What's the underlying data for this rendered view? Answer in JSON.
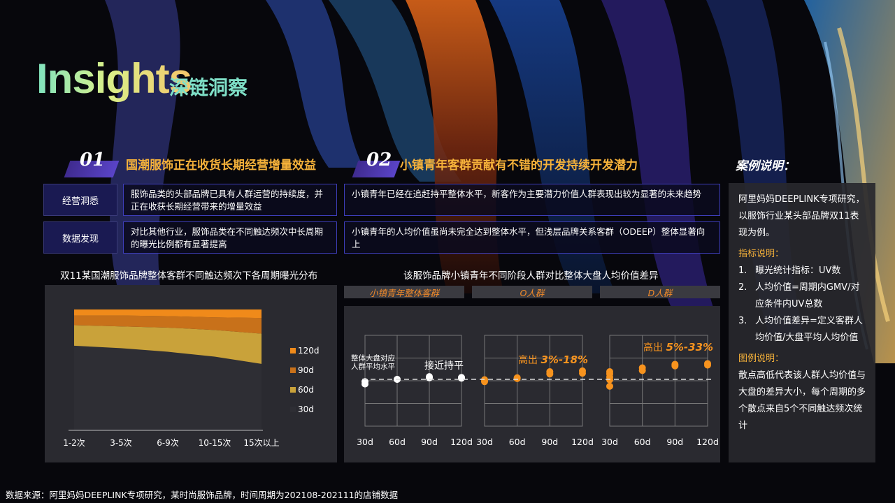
{
  "header": {
    "title_en": "Insights",
    "title_cn": "深链洞察"
  },
  "sections": [
    {
      "num": "01",
      "title": "国潮服饰正在收货长期经营增量效益"
    },
    {
      "num": "02",
      "title": "小镇青年客群贡献有不错的开发持续开发潜力"
    }
  ],
  "rows": [
    {
      "label": "经营洞悉",
      "text1": "服饰品类的头部品牌已具有人群运营的持续度，并正在收获长期经营带来的增量效益",
      "text2": "小镇青年已经在追赶持平整体水平，新客作为主要潜力价值人群表现出较为显著的未来趋势"
    },
    {
      "label": "数据发现",
      "text1": "对比其他行业，服饰品类在不同触达频次中长周期的曝光比例都有显著提高",
      "text2": "小镇青年的人均价值虽尚未完全达到整体水平，但浅层品牌关系客群（ODEEP）整体显著向上"
    }
  ],
  "side": {
    "title": "案例说明：",
    "intro": "阿里妈妈DEEPLINK专项研究，以服饰行业某头部品牌双11表现为例。",
    "metrics_title": "指标说明：",
    "metrics": [
      {
        "n": "1.",
        "text": "曝光统计指标：UV数"
      },
      {
        "n": "2.",
        "text": "人均价值=周期内GMV/对应条件内UV总数"
      },
      {
        "n": "3.",
        "text": "人均价值差异=定义客群人均价值/大盘平均人均价值"
      }
    ],
    "legend_title": "图例说明：",
    "legend_text": "散点高低代表该人群人均价值与大盘的差异大小，每个周期的多个散点来自5个不同触达频次统计"
  },
  "footer": "数据来源：阿里妈妈DEEPLINK专项研究，某时尚服饰品牌，时间周期为202108-202111的店铺数据",
  "colors": {
    "accent": "#f6b23a",
    "orange": "#f7931e",
    "purple": "#3f2b8f"
  },
  "chart_data": [
    {
      "type": "area",
      "title": "双11某国潮服饰品牌整体客群不同触达频次下各周期曝光分布",
      "categories": [
        "1-2次",
        "3-5次",
        "6-9次",
        "10-15次",
        "15次以上"
      ],
      "stacked_percent": true,
      "series": [
        {
          "name": "30d",
          "values": [
            70,
            68,
            65,
            61,
            55
          ],
          "color": "#2e2e34"
        },
        {
          "name": "60d",
          "values": [
            17,
            18,
            20,
            22,
            25
          ],
          "color": "#c9a23a"
        },
        {
          "name": "90d",
          "values": [
            8,
            9,
            9.5,
            10.5,
            13
          ],
          "color": "#c8711a"
        },
        {
          "name": "120d",
          "values": [
            5,
            5,
            5.5,
            6.5,
            7
          ],
          "color": "#f08a1a"
        }
      ],
      "legend_labels": [
        "120d",
        "90d",
        "60d",
        "30d"
      ],
      "legend_position": "right"
    },
    {
      "type": "scatter",
      "title": "该服饰品牌小镇青年不同阶段人群对比整体大盘人均价值差异",
      "baseline_label": "整体大盘对应人群平均水平",
      "x_ticks": [
        "30d",
        "60d",
        "90d",
        "120d"
      ],
      "panels": [
        {
          "tag": "小镇青年整体客群",
          "annotation": "接近持平",
          "annotation_highlight": "",
          "points": [
            [
              0,
              -0.6
            ],
            [
              0,
              -0.3
            ],
            [
              1,
              0.0
            ],
            [
              1,
              0.0
            ],
            [
              2,
              0.35
            ],
            [
              2,
              0.2
            ],
            [
              3,
              0.25
            ],
            [
              3,
              0.15
            ]
          ]
        },
        {
          "tag": "O人群",
          "annotation": "高出 ",
          "annotation_highlight": "3%-18%",
          "points": [
            [
              0,
              -0.05
            ],
            [
              0,
              -0.3
            ],
            [
              1,
              0.1
            ],
            [
              1,
              0.2
            ],
            [
              2,
              1.0
            ],
            [
              2,
              0.7
            ],
            [
              3,
              1.1
            ],
            [
              3,
              0.8
            ]
          ]
        },
        {
          "tag": "D人群",
          "annotation": "高出 ",
          "annotation_highlight": "5%-33%",
          "points": [
            [
              0,
              1.0
            ],
            [
              0,
              0.7
            ],
            [
              0,
              0.3
            ],
            [
              0,
              -0.05
            ],
            [
              0,
              -0.9
            ],
            [
              1,
              1.5
            ],
            [
              1,
              1.15
            ],
            [
              2,
              1.95
            ],
            [
              2,
              1.75
            ],
            [
              3,
              2.05
            ],
            [
              3,
              1.85
            ]
          ]
        }
      ]
    }
  ]
}
